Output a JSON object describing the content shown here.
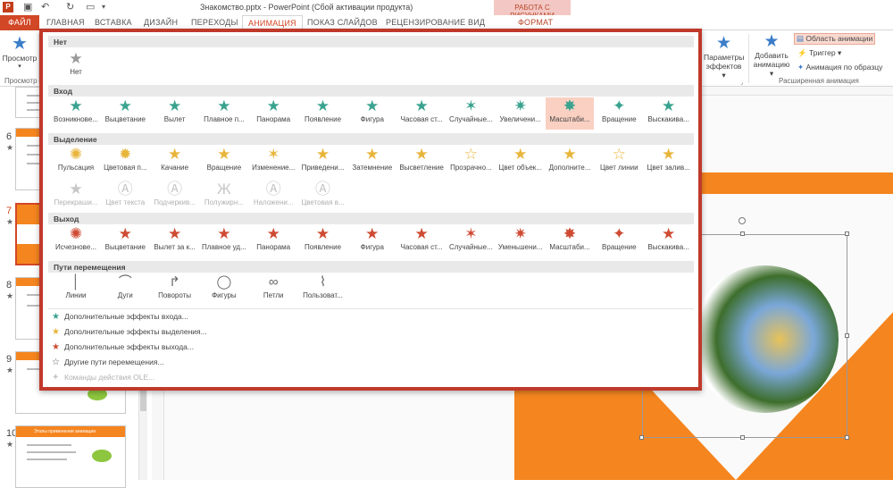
{
  "window": {
    "title": "Знакомство.pptx - PowerPoint (Сбой активации продукта)",
    "context_header": "РАБОТА С РИСУНКАМИ",
    "app_logo": "P"
  },
  "tabs": [
    {
      "label": "ФАЙЛ"
    },
    {
      "label": "ГЛАВНАЯ"
    },
    {
      "label": "ВСТАВКА"
    },
    {
      "label": "ДИЗАЙН"
    },
    {
      "label": "ПЕРЕХОДЫ"
    },
    {
      "label": "АНИМАЦИЯ"
    },
    {
      "label": "ПОКАЗ СЛАЙДОВ"
    },
    {
      "label": "РЕЦЕНЗИРОВАНИЕ"
    },
    {
      "label": "ВИД"
    },
    {
      "label": "ФОРМАТ"
    }
  ],
  "ribbon": {
    "preview": "Просмотр",
    "preview_group": "Просмотр",
    "effect_params_1": "Параметры",
    "effect_params_2": "эффектов",
    "add_anim_1": "Добавить",
    "add_anim_2": "анимацию",
    "anim_pane": "Область анимации",
    "trigger": "Триггер",
    "anim_painter": "Анимация по образцу",
    "advanced_group": "Расширенная анимация"
  },
  "gallery": {
    "none_header": "Нет",
    "none_items": [
      {
        "label": "Нет"
      }
    ],
    "entrance_header": "Вход",
    "entrance": [
      {
        "label": "Возникнове..."
      },
      {
        "label": "Выцветание"
      },
      {
        "label": "Вылет"
      },
      {
        "label": "Плавное п..."
      },
      {
        "label": "Панорама"
      },
      {
        "label": "Появление"
      },
      {
        "label": "Фигура"
      },
      {
        "label": "Часовая ст..."
      },
      {
        "label": "Случайные..."
      },
      {
        "label": "Увеличени..."
      },
      {
        "label": "Масштаби..."
      },
      {
        "label": "Вращение"
      },
      {
        "label": "Выскакива..."
      }
    ],
    "emphasis_header": "Выделение",
    "emphasis": [
      {
        "label": "Пульсация"
      },
      {
        "label": "Цветовая п..."
      },
      {
        "label": "Качание"
      },
      {
        "label": "Вращение"
      },
      {
        "label": "Изменение..."
      },
      {
        "label": "Приведени..."
      },
      {
        "label": "Затемнение"
      },
      {
        "label": "Высветление"
      },
      {
        "label": "Прозрачно..."
      },
      {
        "label": "Цвет объек..."
      },
      {
        "label": "Дополните..."
      },
      {
        "label": "Цвет линии"
      },
      {
        "label": "Цвет залив..."
      }
    ],
    "emphasis_disabled": [
      {
        "label": "Перекраши..."
      },
      {
        "label": "Цвет текста"
      },
      {
        "label": "Подчеркив..."
      },
      {
        "label": "Полужирн..."
      },
      {
        "label": "Наложени..."
      },
      {
        "label": "Цветовая в..."
      }
    ],
    "exit_header": "Выход",
    "exit": [
      {
        "label": "Исчезнове..."
      },
      {
        "label": "Выцветание"
      },
      {
        "label": "Вылет за к..."
      },
      {
        "label": "Плавное уд..."
      },
      {
        "label": "Панорама"
      },
      {
        "label": "Появление"
      },
      {
        "label": "Фигура"
      },
      {
        "label": "Часовая ст..."
      },
      {
        "label": "Случайные..."
      },
      {
        "label": "Уменьшени..."
      },
      {
        "label": "Масштаби..."
      },
      {
        "label": "Вращение"
      },
      {
        "label": "Выскакива..."
      }
    ],
    "paths_header": "Пути перемещения",
    "paths": [
      {
        "label": "Линии"
      },
      {
        "label": "Дуги"
      },
      {
        "label": "Повороты"
      },
      {
        "label": "Фигуры"
      },
      {
        "label": "Петли"
      },
      {
        "label": "Пользоват..."
      }
    ],
    "more": [
      {
        "label": "Дополнительные эффекты входа..."
      },
      {
        "label": "Дополнительные эффекты выделения..."
      },
      {
        "label": "Дополнительные эффекты выхода..."
      },
      {
        "label": "Другие пути перемещения..."
      },
      {
        "label": "Команды действия OLE..."
      }
    ]
  },
  "slides": [
    {
      "num": "6"
    },
    {
      "num": "7"
    },
    {
      "num": "8"
    },
    {
      "num": "9"
    },
    {
      "num": "10"
    }
  ],
  "thumb10_text": "Этапы применения анимации",
  "colors": {
    "accent": "#d24726",
    "highlight_border": "#c0392b",
    "entrance": "#3aa38f",
    "emphasis": "#e8b53b",
    "exit": "#cf4a33",
    "slide_orange": "#f5851f"
  }
}
